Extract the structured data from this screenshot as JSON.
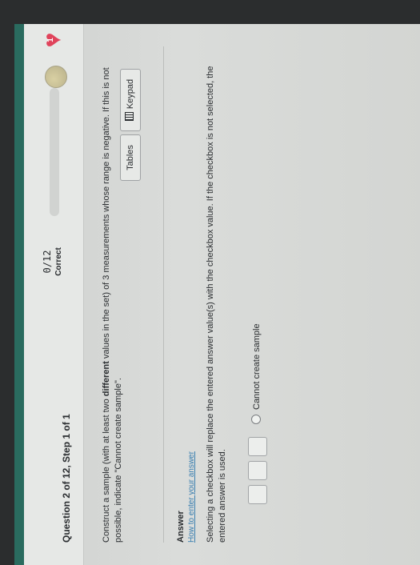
{
  "header": {
    "question_title": "Question 2 of 12, Step 1 of 1",
    "score": "0/12",
    "score_label": "Correct",
    "hearts": "1"
  },
  "question": {
    "text_before": "Construct a sample (with at least two ",
    "text_bold": "different",
    "text_after": " values in the set) of 3 measurements whose range is negative. If this is not possible, indicate \"Cannot create sample\"."
  },
  "tools": {
    "tables_label": "Tables",
    "keypad_label": "Keypad"
  },
  "answer": {
    "label": "Answer",
    "howto_link": "How to enter your answer",
    "instructions": "Selecting a checkbox will replace the entered answer value(s) with the checkbox value. If the checkbox is not selected, the entered answer is used.",
    "cannot_label": "Cannot create sample",
    "values": [
      "",
      "",
      ""
    ]
  },
  "colors": {
    "accent": "#2a6b5f",
    "link": "#3a7fb0",
    "heart": "#e0435b"
  }
}
